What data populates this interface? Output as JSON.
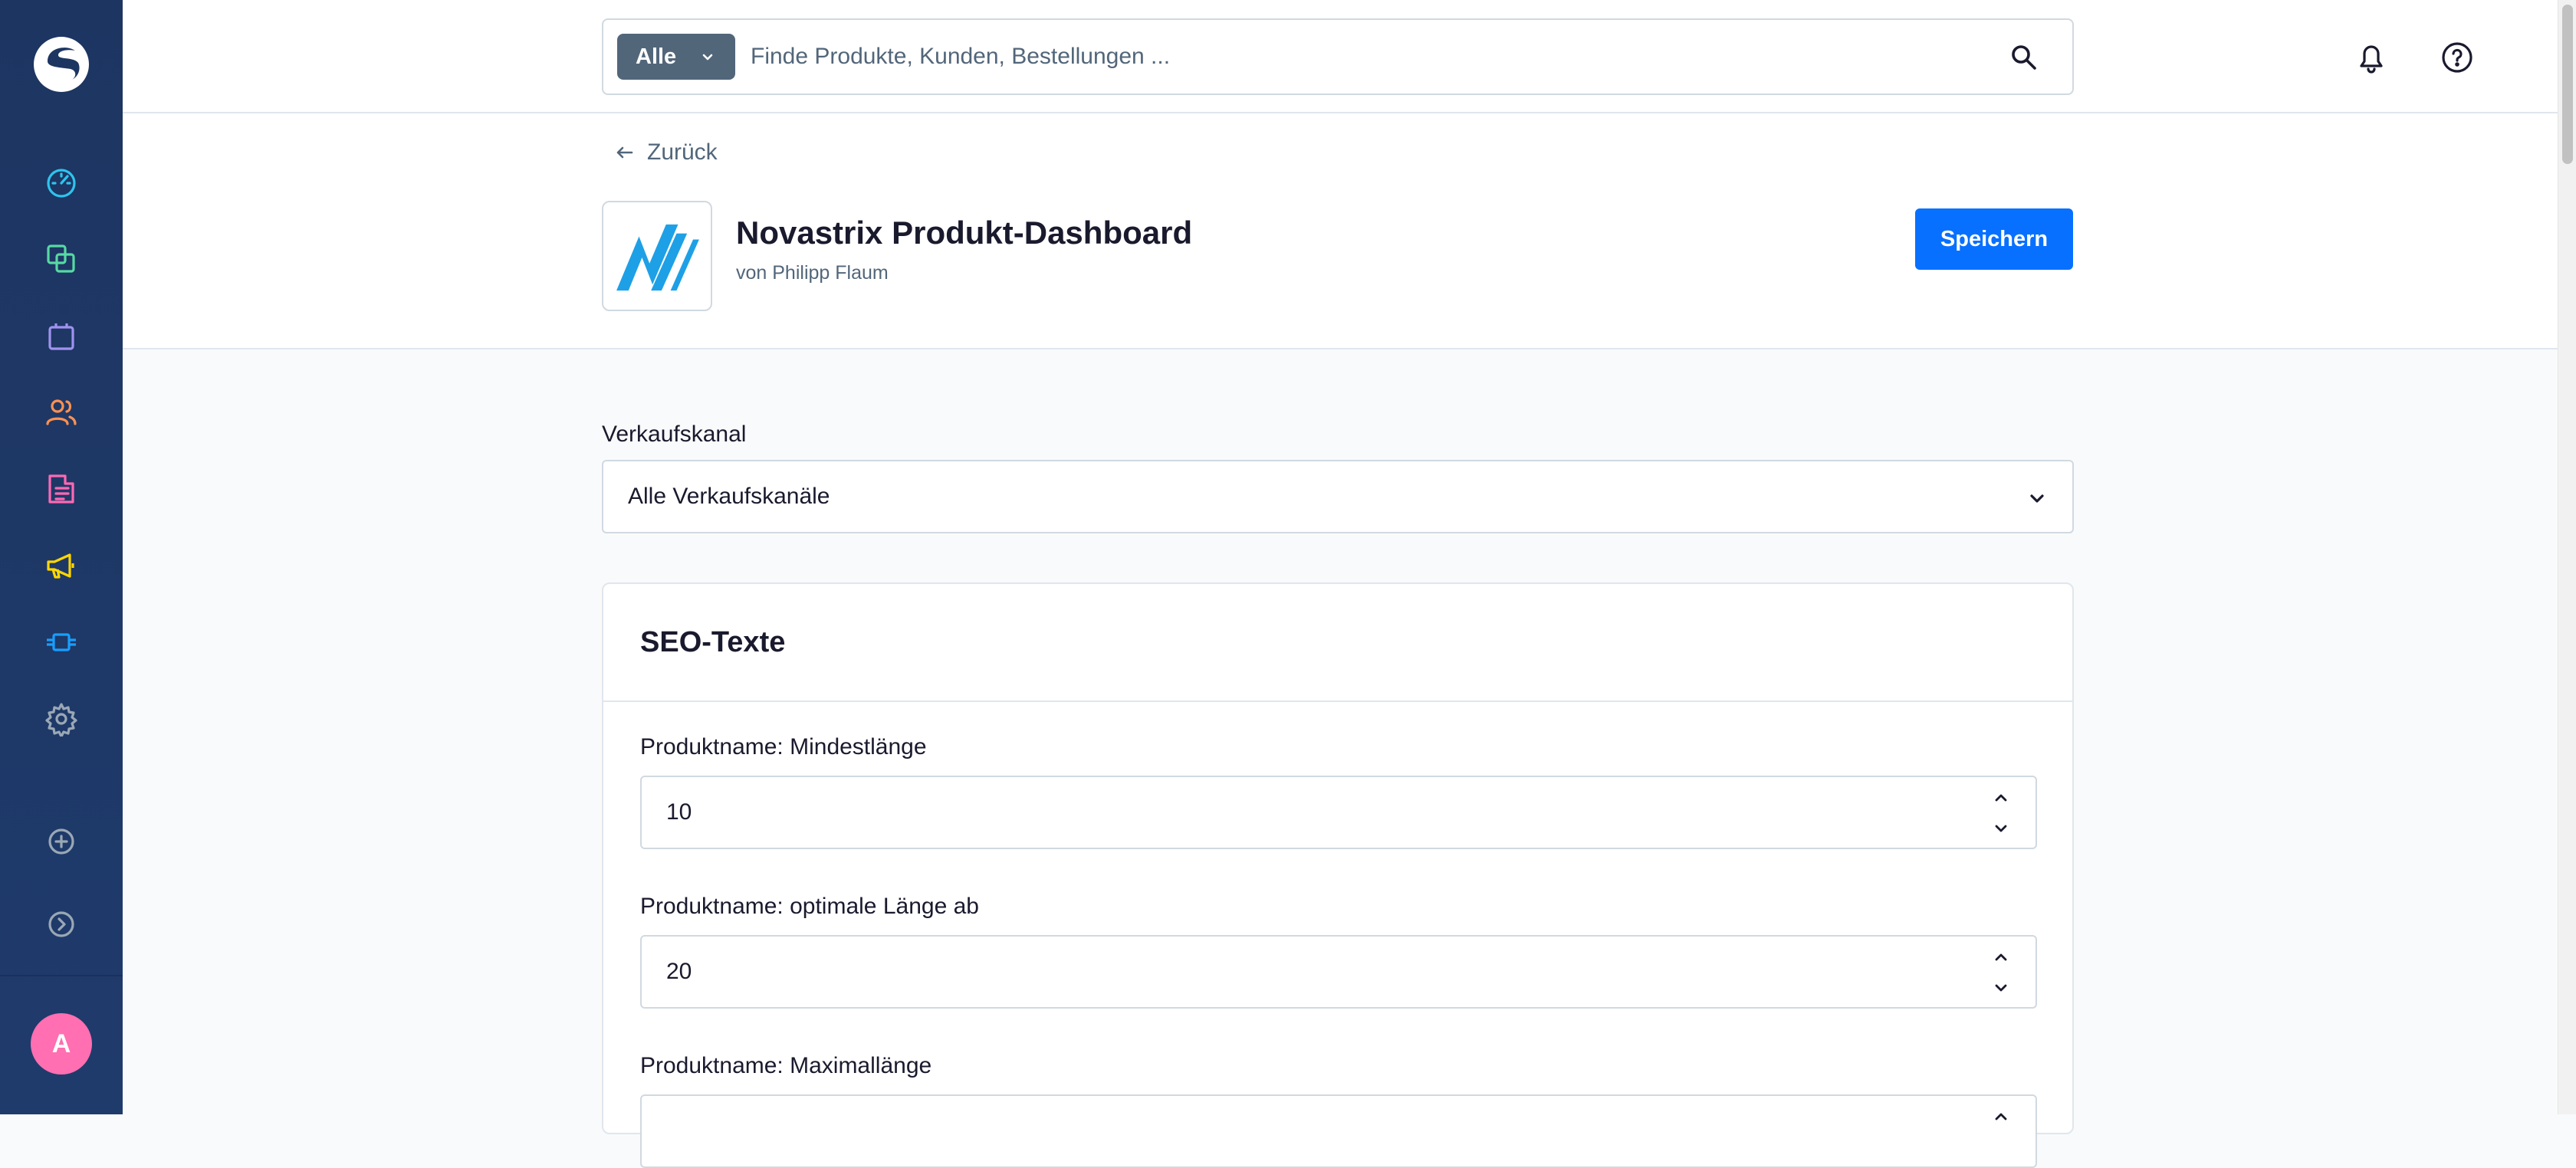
{
  "sidebar": {
    "items": [
      {
        "name": "dashboard-icon",
        "color": "#2ec4ee"
      },
      {
        "name": "catalog-icon",
        "color": "#57d9a3"
      },
      {
        "name": "orders-icon",
        "color": "#a092f0"
      },
      {
        "name": "customers-icon",
        "color": "#ff9151"
      },
      {
        "name": "content-icon",
        "color": "#ff68b4"
      },
      {
        "name": "marketing-icon",
        "color": "#ffd700"
      },
      {
        "name": "extensions-icon",
        "color": "#189eff"
      },
      {
        "name": "settings-icon",
        "color": "#9aa8b5"
      }
    ],
    "avatar_initial": "A",
    "avatar_color": "#ff6fb1"
  },
  "search": {
    "scope_label": "Alle",
    "placeholder": "Finde Produkte, Kunden, Bestellungen ..."
  },
  "header": {
    "back_label": "Zurück",
    "app_title": "Novastrix Produkt-Dashboard",
    "app_author": "von Philipp Flaum",
    "save_label": "Speichern"
  },
  "form": {
    "sales_channel_label": "Verkaufskanal",
    "sales_channel_value": "Alle Verkaufskanäle",
    "card_title": "SEO-Texte",
    "fields": [
      {
        "label": "Produktname: Mindestlänge",
        "value": "10"
      },
      {
        "label": "Produktname: optimale Länge ab",
        "value": "20"
      },
      {
        "label": "Produktname: Maximallänge",
        "value": ""
      }
    ]
  },
  "colors": {
    "primary": "#0870ff",
    "sidebar_bg": "#1f3a6e"
  }
}
